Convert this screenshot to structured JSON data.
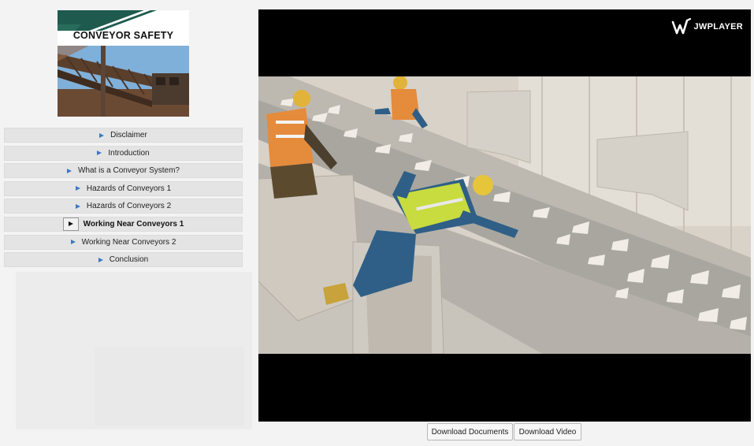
{
  "course": {
    "title": "CONVEYOR SAFETY"
  },
  "menu": {
    "items": [
      {
        "label": "Disclaimer",
        "active": false
      },
      {
        "label": "Introduction",
        "active": false
      },
      {
        "label": "What is a Conveyor System?",
        "active": false
      },
      {
        "label": "Hazards of Conveyors 1",
        "active": false
      },
      {
        "label": "Hazards of Conveyors 2",
        "active": false
      },
      {
        "label": "Working Near Conveyors 1",
        "active": true
      },
      {
        "label": "Working Near Conveyors 2",
        "active": false
      },
      {
        "label": "Conclusion",
        "active": false
      }
    ]
  },
  "player": {
    "brand": "JWPLAYER"
  },
  "actions": {
    "download_documents": "Download Documents",
    "download_video": "Download Video"
  },
  "colors": {
    "brand_green": "#1e5a4e",
    "menu_arrow": "#3d78c2",
    "menu_bg": "#e4e4e4"
  }
}
